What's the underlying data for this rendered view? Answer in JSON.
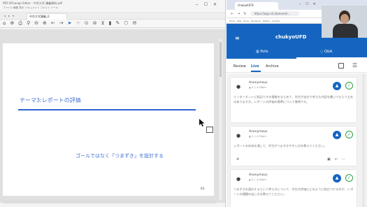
{
  "viewer": {
    "title_text": "PDF-XChange Editor - 中京大学 講義資料.pdf",
    "menu_text": "ファイル 編集 表示 ドキュメント コメント ツール",
    "tab_label": "中京大学講義_6",
    "toolbar_icons": [
      "home-icon",
      "save-icon",
      "print-icon",
      "search-icon",
      "zoom-out-icon",
      "zoom-in-icon",
      "back-icon",
      "forward-icon",
      "select-icon",
      "hand-icon",
      "zoom-icon",
      "pen-icon",
      "stamp-icon",
      "filter-icon",
      "highlight-icon",
      "shape-icon",
      "comment-icon"
    ]
  },
  "slide": {
    "title": "テーマ3:レポートの評価",
    "subtitle": "ゴールではなく「つまずき」を設計する",
    "page_number": "61"
  },
  "browser": {
    "tab_label": "chukyoUFD",
    "url": "https://app.sli.do/event/…",
    "bookmarks": "Sli.do · Mail · Drive · Facebook · Twitter · Amazon"
  },
  "app": {
    "name": "chukyoUFD",
    "tabs": {
      "polls": "Polls",
      "qa": "Q&A"
    },
    "filters": {
      "review": "Review",
      "live": "Live",
      "archive": "Archive"
    }
  },
  "questions": [
    {
      "author": "Anonymous",
      "meta": "▲ 0 ○ 4:20pm",
      "text": "インターネットに転記できる情報をまとめて、学生が自分で考えた内容を書いてもらう工夫はありますか。レポートの評価の基準について質問です。"
    },
    {
      "author": "Anonymous",
      "meta": "▲ 0 ○ 4:31pm",
      "text": "レポートの作成を通して、学生がつまずきやすい点を教えてください。"
    },
    {
      "author": "Anonymous",
      "meta": "▲ 0 ○ 4:33pm",
      "text": "つまずきを設計するという考え方について、学生の評価にどのように結びつけるのか、レポートの課題の出し方を教えてください。"
    }
  ],
  "colors": {
    "accent": "#1565c0",
    "slide_text": "#3f6fd1",
    "answered": "#2e9e44"
  }
}
